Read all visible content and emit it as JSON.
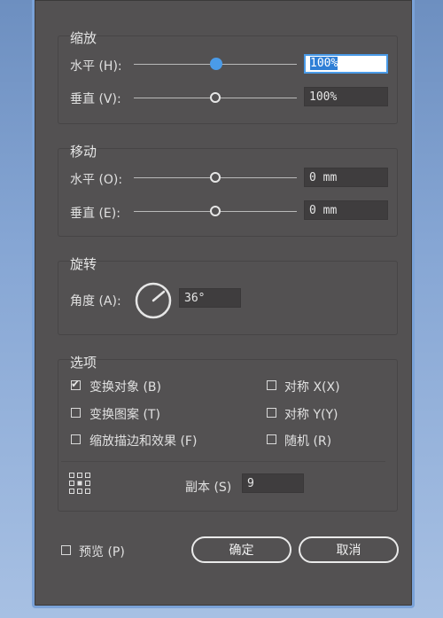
{
  "scale": {
    "title": "缩放",
    "horizontal_label": "水平 (H):",
    "horizontal_value": "100%",
    "vertical_label": "垂直 (V):",
    "vertical_value": "100%"
  },
  "move": {
    "title": "移动",
    "horizontal_label": "水平 (O):",
    "horizontal_value": "0 mm",
    "vertical_label": "垂直 (E):",
    "vertical_value": "0 mm"
  },
  "rotate": {
    "title": "旋转",
    "angle_label": "角度 (A):",
    "angle_value": "36°"
  },
  "options": {
    "title": "选项",
    "transform_objects": {
      "label": "变换对象 (B)",
      "checked": true
    },
    "transform_patterns": {
      "label": "变换图案 (T)",
      "checked": false
    },
    "scale_strokes": {
      "label": "缩放描边和效果 (F)",
      "checked": false
    },
    "reflect_x": {
      "label": "对称 X(X)",
      "checked": false
    },
    "reflect_y": {
      "label": "对称 Y(Y)",
      "checked": false
    },
    "random": {
      "label": "随机 (R)",
      "checked": false
    },
    "copies_label": "副本 (S)",
    "copies_value": "9",
    "reference_point_icon": "reference-point-grid-icon"
  },
  "footer": {
    "preview": {
      "label": "预览 (P)",
      "checked": false
    },
    "ok_label": "确定",
    "cancel_label": "取消"
  },
  "colors": {
    "dialog_bg": "#535152",
    "accent": "#4a9be8",
    "field_bg": "#3f3d3e"
  }
}
